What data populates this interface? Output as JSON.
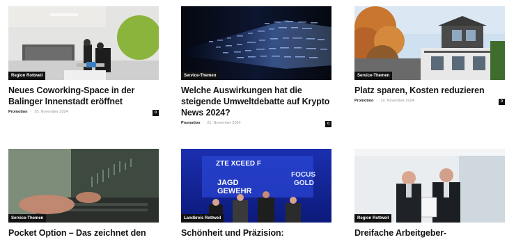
{
  "articles": [
    {
      "category": "Region Rottweil",
      "title": "Neues Coworking-Space in der Balinger Innenstadt eröffnet",
      "author": "Promotion",
      "date": "20. November 2024",
      "comments": "0"
    },
    {
      "category": "Service-Themen",
      "title": "Welche Auswirkungen hat die steigende Umweltdebatte auf Krypto News 2024?",
      "author": "Promotion",
      "date": "21. November 2024",
      "comments": "0"
    },
    {
      "category": "Service-Themen",
      "title": "Platz sparen, Kosten reduzieren",
      "author": "Promotion",
      "date": "19. November 2024",
      "comments": "0"
    },
    {
      "category": "Service-Themen",
      "title": "Pocket Option – Das zeichnet den",
      "author": "",
      "date": "",
      "comments": ""
    },
    {
      "category": "Landkreis Rottweil",
      "title": "Schönheit und Präzision:",
      "author": "",
      "date": "",
      "comments": ""
    },
    {
      "category": "Region Rottweil",
      "title": "Dreifache Arbeitgeber-",
      "author": "",
      "date": "",
      "comments": ""
    }
  ],
  "photo_texts": {
    "banner_line1": "ZTE XCEED F",
    "banner_line2": "JAGD",
    "banner_line3": "GEWEHR",
    "banner_right1": "FOCUS",
    "banner_right2": "GOLD"
  }
}
